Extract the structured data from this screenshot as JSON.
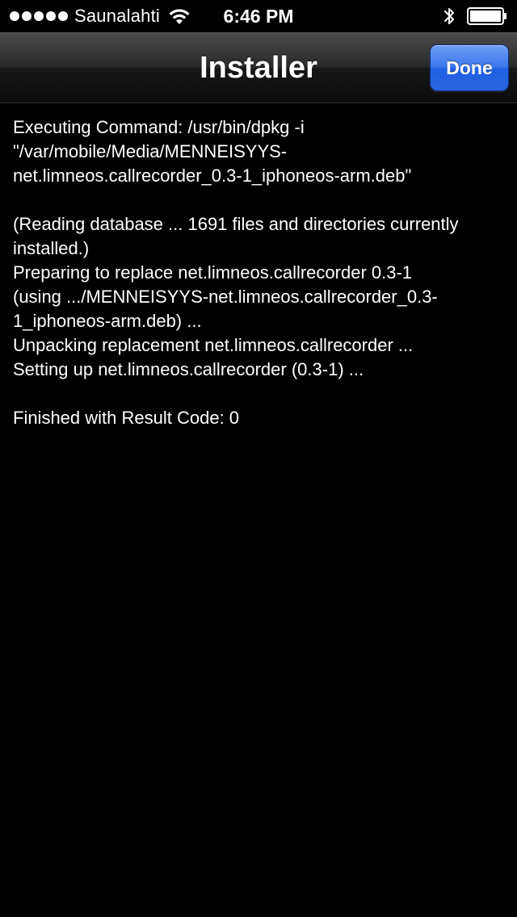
{
  "status_bar": {
    "signal_dots": 5,
    "carrier": "Saunalahti",
    "time": "6:46 PM",
    "icons": [
      "wifi-icon",
      "bluetooth-icon",
      "battery-icon"
    ]
  },
  "nav_bar": {
    "title": "Installer",
    "done_label": "Done",
    "done_color": "#2f6ee6"
  },
  "console": {
    "lines": [
      "Executing Command: /usr/bin/dpkg -i",
      "\"/var/mobile/Media/MENNEISYYS-",
      "net.limneos.callrecorder_0.3-1_iphoneos-arm.deb\"",
      "",
      "(Reading database ... 1691 files and directories currently",
      "installed.)",
      "Preparing to replace net.limneos.callrecorder 0.3-1",
      "(using .../MENNEISYYS-net.limneos.callrecorder_0.3-",
      "1_iphoneos-arm.deb) ...",
      "Unpacking replacement net.limneos.callrecorder ...",
      "Setting up net.limneos.callrecorder (0.3-1) ...",
      "",
      "Finished with Result Code: 0"
    ]
  }
}
